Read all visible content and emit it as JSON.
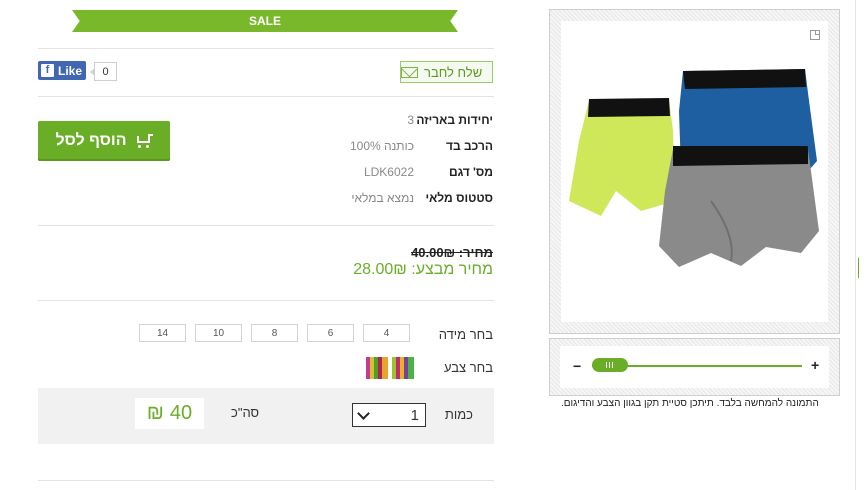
{
  "sale_ribbon": "SALE",
  "social": {
    "fb_like_label": "Like",
    "fb_count": "0",
    "send_friend_label": "שלח לחבר"
  },
  "cart": {
    "add_label": "הוסף לסל"
  },
  "specs": [
    {
      "label": "יחידות באריזה",
      "value": "3"
    },
    {
      "label": "הרכב בד",
      "value": "כותנה 100%"
    },
    {
      "label": "מס' דגם",
      "value": "LDK6022"
    },
    {
      "label": "סטטוס מלאי",
      "value": "נמצא במלאי"
    }
  ],
  "price": {
    "old": "מחיר: 40.00₪",
    "sale": "מחיר מבצע: 28.00₪"
  },
  "size": {
    "label": "בחר מידה",
    "options": [
      "4",
      "6",
      "8",
      "10",
      "14"
    ]
  },
  "color": {
    "label": "בחר צבע",
    "swatches": [
      "multicolor-stripe-1",
      "multicolor-stripe-2"
    ]
  },
  "quantity": {
    "label": "כמות",
    "value": "1",
    "total_label": "סה\"כ",
    "total_value": "40",
    "currency": "₪"
  },
  "image": {
    "disclaimer": "התמונה להמחשה בלבד. תיתכן סטיית תקן בגוון הצבע והדיגום.",
    "zoom_minus": "−",
    "zoom_plus": "+",
    "zoom_level": 0.0
  },
  "colors": {
    "accent": "#6aae27",
    "fb_blue": "#4267b2"
  }
}
